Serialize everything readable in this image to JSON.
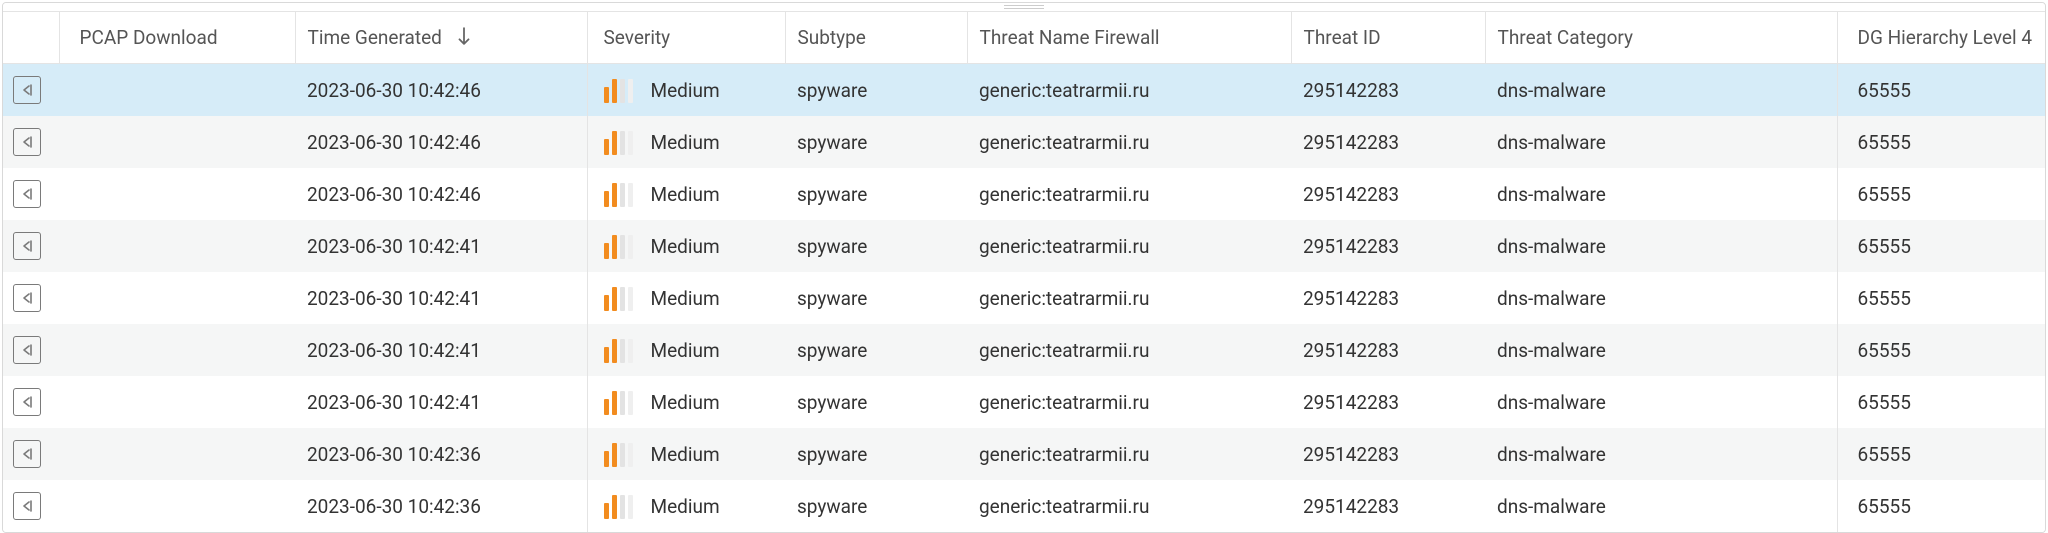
{
  "columns": {
    "expand": "",
    "pcap": "PCAP Download",
    "time": "Time Generated",
    "severity": "Severity",
    "subtype": "Subtype",
    "threat_name": "Threat Name Firewall",
    "threat_id": "Threat ID",
    "threat_category": "Threat Category",
    "dg_level": "DG Hierarchy Level 4"
  },
  "sort": {
    "column": "time",
    "direction": "desc"
  },
  "rows": [
    {
      "selected": true,
      "time": "2023-06-30 10:42:46",
      "severity": "Medium",
      "subtype": "spyware",
      "threat_name": "generic:teatrarmii.ru",
      "threat_id": "295142283",
      "threat_category": "dns-malware",
      "dg_level": "65555"
    },
    {
      "selected": false,
      "time": "2023-06-30 10:42:46",
      "severity": "Medium",
      "subtype": "spyware",
      "threat_name": "generic:teatrarmii.ru",
      "threat_id": "295142283",
      "threat_category": "dns-malware",
      "dg_level": "65555"
    },
    {
      "selected": false,
      "time": "2023-06-30 10:42:46",
      "severity": "Medium",
      "subtype": "spyware",
      "threat_name": "generic:teatrarmii.ru",
      "threat_id": "295142283",
      "threat_category": "dns-malware",
      "dg_level": "65555"
    },
    {
      "selected": false,
      "time": "2023-06-30 10:42:41",
      "severity": "Medium",
      "subtype": "spyware",
      "threat_name": "generic:teatrarmii.ru",
      "threat_id": "295142283",
      "threat_category": "dns-malware",
      "dg_level": "65555"
    },
    {
      "selected": false,
      "time": "2023-06-30 10:42:41",
      "severity": "Medium",
      "subtype": "spyware",
      "threat_name": "generic:teatrarmii.ru",
      "threat_id": "295142283",
      "threat_category": "dns-malware",
      "dg_level": "65555"
    },
    {
      "selected": false,
      "time": "2023-06-30 10:42:41",
      "severity": "Medium",
      "subtype": "spyware",
      "threat_name": "generic:teatrarmii.ru",
      "threat_id": "295142283",
      "threat_category": "dns-malware",
      "dg_level": "65555"
    },
    {
      "selected": false,
      "time": "2023-06-30 10:42:41",
      "severity": "Medium",
      "subtype": "spyware",
      "threat_name": "generic:teatrarmii.ru",
      "threat_id": "295142283",
      "threat_category": "dns-malware",
      "dg_level": "65555"
    },
    {
      "selected": false,
      "time": "2023-06-30 10:42:36",
      "severity": "Medium",
      "subtype": "spyware",
      "threat_name": "generic:teatrarmii.ru",
      "threat_id": "295142283",
      "threat_category": "dns-malware",
      "dg_level": "65555"
    },
    {
      "selected": false,
      "time": "2023-06-30 10:42:36",
      "severity": "Medium",
      "subtype": "spyware",
      "threat_name": "generic:teatrarmii.ru",
      "threat_id": "295142283",
      "threat_category": "dns-malware",
      "dg_level": "65555"
    }
  ]
}
